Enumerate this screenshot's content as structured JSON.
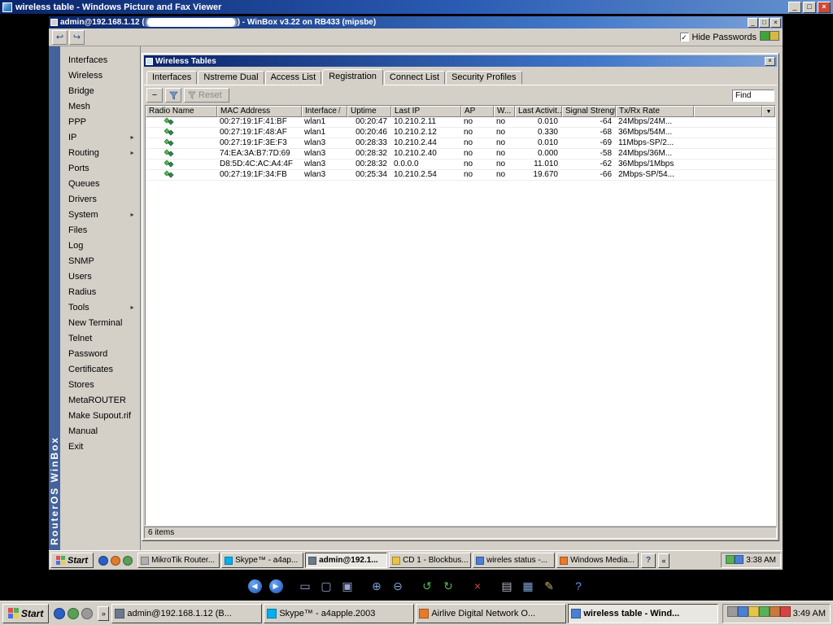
{
  "viewer": {
    "title": "wireless table - Windows Picture and Fax Viewer",
    "window_buttons": {
      "minimize": "_",
      "maximize": "□",
      "close": "×"
    },
    "toolbar": [
      {
        "name": "previous-image-button",
        "glyph": "◀",
        "circle": true
      },
      {
        "name": "next-image-button",
        "glyph": "▶",
        "circle": true
      },
      {
        "name": "best-fit-button",
        "glyph": "▭",
        "color": "#9aa4d4"
      },
      {
        "name": "actual-size-button",
        "glyph": "▢",
        "color": "#9aa4d4"
      },
      {
        "name": "slideshow-button",
        "glyph": "▣",
        "color": "#9aa4d4"
      },
      {
        "name": "zoom-in-button",
        "glyph": "⊕",
        "color": "#7fa3d8"
      },
      {
        "name": "zoom-out-button",
        "glyph": "⊖",
        "color": "#7fa3d8"
      },
      {
        "name": "rotate-counterclockwise-button",
        "glyph": "↺",
        "color": "#57b657"
      },
      {
        "name": "rotate-clockwise-button",
        "glyph": "↻",
        "color": "#57b657"
      },
      {
        "name": "delete-button",
        "glyph": "×",
        "color": "#d84a3a"
      },
      {
        "name": "print-button",
        "glyph": "▤",
        "color": "#b8bcc8"
      },
      {
        "name": "save-button",
        "glyph": "▦",
        "color": "#7fa3d8"
      },
      {
        "name": "edit-button",
        "glyph": "✎",
        "color": "#c8b870"
      },
      {
        "name": "help-button",
        "glyph": "?",
        "color": "#6f8fe8"
      }
    ]
  },
  "winbox": {
    "title_prefix": "admin@192.168.1.12 (",
    "title_suffix": ") - WinBox v3.22 on RB433 (mipsbe)",
    "window_buttons": {
      "minimize": "_",
      "maximize": "□",
      "close": "×"
    },
    "toolbar": {
      "undo_glyph": "↩",
      "redo_glyph": "↪",
      "checkmark": "✓",
      "hide_passwords_label": "Hide Passwords",
      "status_icons": [
        {
          "name": "session-indicator-icon",
          "color": "#3aa63a"
        },
        {
          "name": "safe-mode-lock-icon",
          "color": "#d8b840"
        }
      ]
    },
    "sidebar": {
      "banner": "RouterOS WinBox",
      "submenu_arrow_glyph": "►",
      "items": [
        {
          "name": "sidebar-item-interfaces",
          "label": "Interfaces"
        },
        {
          "name": "sidebar-item-wireless",
          "label": "Wireless"
        },
        {
          "name": "sidebar-item-bridge",
          "label": "Bridge"
        },
        {
          "name": "sidebar-item-mesh",
          "label": "Mesh"
        },
        {
          "name": "sidebar-item-ppp",
          "label": "PPP"
        },
        {
          "name": "sidebar-item-ip",
          "label": "IP",
          "arrow": true
        },
        {
          "name": "sidebar-item-routing",
          "label": "Routing",
          "arrow": true
        },
        {
          "name": "sidebar-item-ports",
          "label": "Ports"
        },
        {
          "name": "sidebar-item-queues",
          "label": "Queues"
        },
        {
          "name": "sidebar-item-drivers",
          "label": "Drivers"
        },
        {
          "name": "sidebar-item-system",
          "label": "System",
          "arrow": true
        },
        {
          "name": "sidebar-item-files",
          "label": "Files"
        },
        {
          "name": "sidebar-item-log",
          "label": "Log"
        },
        {
          "name": "sidebar-item-snmp",
          "label": "SNMP"
        },
        {
          "name": "sidebar-item-users",
          "label": "Users"
        },
        {
          "name": "sidebar-item-radius",
          "label": "Radius"
        },
        {
          "name": "sidebar-item-tools",
          "label": "Tools",
          "arrow": true
        },
        {
          "name": "sidebar-item-new-terminal",
          "label": "New Terminal"
        },
        {
          "name": "sidebar-item-telnet",
          "label": "Telnet"
        },
        {
          "name": "sidebar-item-password",
          "label": "Password"
        },
        {
          "name": "sidebar-item-certificates",
          "label": "Certificates"
        },
        {
          "name": "sidebar-item-stores",
          "label": "Stores"
        },
        {
          "name": "sidebar-item-metarouter",
          "label": "MetaROUTER"
        },
        {
          "name": "sidebar-item-make-supout",
          "label": "Make Supout.rif"
        },
        {
          "name": "sidebar-item-manual",
          "label": "Manual"
        },
        {
          "name": "sidebar-item-exit",
          "label": "Exit"
        }
      ]
    },
    "wireless_tables": {
      "title": "Wireless Tables",
      "close_glyph": "×",
      "tabs": [
        {
          "name": "tab-interfaces",
          "label": "Interfaces"
        },
        {
          "name": "tab-nstreme-dual",
          "label": "Nstreme Dual"
        },
        {
          "name": "tab-access-list",
          "label": "Access List"
        },
        {
          "name": "tab-registration",
          "label": "Registration",
          "active": true
        },
        {
          "name": "tab-connect-list",
          "label": "Connect List"
        },
        {
          "name": "tab-security-profiles",
          "label": "Security Profiles"
        }
      ],
      "minus_button": "−",
      "reset_label": "Reset",
      "find_label": "Find",
      "columns": [
        "Radio Name",
        "MAC Address",
        "Interface",
        "Uptime",
        "Last IP",
        "AP",
        "W...",
        "Last Activit...",
        "Signal Strengt...",
        "Tx/Rx Rate"
      ],
      "sort_indicator": "/",
      "header_dropdown_glyph": "▼",
      "rows": [
        {
          "mac": "00:27:19:1F:41:BF",
          "interface": "wlan1",
          "uptime": "00:20:47",
          "last_ip": "10.210.2.11",
          "ap": "no",
          "wds": "no",
          "last_activity": "0.010",
          "signal": "-64",
          "rate": "24Mbps/24M..."
        },
        {
          "mac": "00:27:19:1F:48:AF",
          "interface": "wlan1",
          "uptime": "00:20:46",
          "last_ip": "10.210.2.12",
          "ap": "no",
          "wds": "no",
          "last_activity": "0.330",
          "signal": "-68",
          "rate": "36Mbps/54M..."
        },
        {
          "mac": "00:27:19:1F:3E:F3",
          "interface": "wlan3",
          "uptime": "00:28:33",
          "last_ip": "10.210.2.44",
          "ap": "no",
          "wds": "no",
          "last_activity": "0.010",
          "signal": "-69",
          "rate": "11Mbps-SP/2..."
        },
        {
          "mac": "74:EA:3A:B7:7D:69",
          "interface": "wlan3",
          "uptime": "00:28:32",
          "last_ip": "10.210.2.40",
          "ap": "no",
          "wds": "no",
          "last_activity": "0.000",
          "signal": "-58",
          "rate": "24Mbps/36M..."
        },
        {
          "mac": "D8:5D:4C:AC:A4:4F",
          "interface": "wlan3",
          "uptime": "00:28:32",
          "last_ip": "0.0.0.0",
          "ap": "no",
          "wds": "no",
          "last_activity": "11.010",
          "signal": "-62",
          "rate": "36Mbps/1Mbps"
        },
        {
          "mac": "00:27:19:1F:34:FB",
          "interface": "wlan3",
          "uptime": "00:25:34",
          "last_ip": "10.210.2.54",
          "ap": "no",
          "wds": "no",
          "last_activity": "19.670",
          "signal": "-66",
          "rate": "2Mbps-SP/54..."
        }
      ],
      "status": "6 items"
    },
    "taskbar": {
      "start_label": "Start",
      "quicklaunch": [
        {
          "name": "quicklaunch-icon",
          "color": "#2a5fc4"
        },
        {
          "name": "quicklaunch-icon",
          "color": "#e07b2a"
        },
        {
          "name": "quicklaunch-icon",
          "color": "#58a058"
        }
      ],
      "tasks": [
        {
          "name": "task-button-mikrotik-router",
          "label": "MikroTik Router...",
          "icon_color": "#b0b0b0"
        },
        {
          "name": "task-button-skype",
          "label": "Skype™ - a4ap...",
          "icon_color": "#00aff0"
        },
        {
          "name": "task-button-admin",
          "label": "admin@192.1...",
          "icon_color": "#6a7a8a",
          "active": true
        },
        {
          "name": "task-button-cd1",
          "label": "CD 1 - Blockbus...",
          "icon_color": "#e8c34a"
        },
        {
          "name": "task-button-wireles-status",
          "label": "wireles status -...",
          "icon_color": "#4a7fd4"
        },
        {
          "name": "task-button-windows-media",
          "label": "Windows Media...",
          "icon_color": "#e87a2a"
        }
      ],
      "help_glyph": "?",
      "chevron": "«",
      "tray_icons": [
        {
          "name": "tray-icon",
          "color": "#58b058"
        },
        {
          "name": "tray-icon",
          "color": "#4a7fd4"
        }
      ],
      "time": "3:38 AM"
    }
  },
  "taskbar": {
    "start_label": "Start",
    "quicklaunch": [
      {
        "name": "quicklaunch-icon",
        "color": "#2a5fc4"
      },
      {
        "name": "quicklaunch-icon",
        "color": "#58a058"
      },
      {
        "name": "quicklaunch-icon",
        "color": "#999999"
      }
    ],
    "chevron": "»",
    "tasks": [
      {
        "name": "task-button-admin",
        "label": "admin@192.168.1.12 (B...",
        "icon_color": "#6a7a8a"
      },
      {
        "name": "task-button-skype",
        "label": "Skype™ - a4apple.2003",
        "icon_color": "#00aff0"
      },
      {
        "name": "task-button-airlive",
        "label": "Airlive Digital Network O...",
        "icon_color": "#e87a2a"
      },
      {
        "name": "task-button-wireless-table",
        "label": "wireless table - Wind...",
        "icon_color": "#4a7fd4",
        "active": true
      }
    ],
    "tray_icons": [
      {
        "name": "tray-icon",
        "color": "#9a9a9a"
      },
      {
        "name": "tray-icon",
        "color": "#4a7fd4"
      },
      {
        "name": "tray-icon",
        "color": "#e8c34a"
      },
      {
        "name": "tray-icon",
        "color": "#58b058"
      },
      {
        "name": "tray-icon",
        "color": "#c87a3a"
      },
      {
        "name": "tray-icon",
        "color": "#d44444"
      }
    ],
    "time": "3:49 AM"
  }
}
